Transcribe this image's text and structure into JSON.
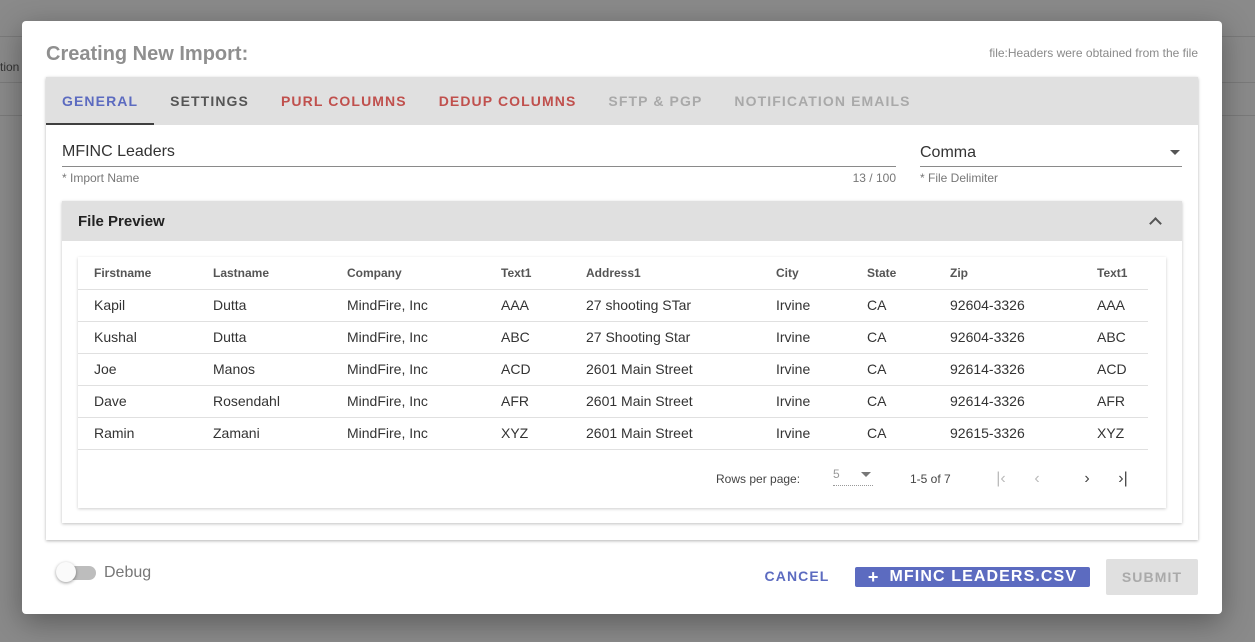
{
  "background": {
    "partial_text": "tion"
  },
  "modal": {
    "title": "Creating New Import:",
    "header_note": "file:Headers were obtained from the file"
  },
  "tabs": [
    {
      "label": "GENERAL",
      "state": "active"
    },
    {
      "label": "SETTINGS",
      "state": "normal"
    },
    {
      "label": "PURL COLUMNS",
      "state": "error"
    },
    {
      "label": "DEDUP COLUMNS",
      "state": "error"
    },
    {
      "label": "SFTP & PGP",
      "state": "disabled"
    },
    {
      "label": "NOTIFICATION EMAILS",
      "state": "disabled"
    }
  ],
  "form": {
    "import_name": {
      "value": "MFINC Leaders",
      "label": "* Import Name",
      "counter": "13 / 100"
    },
    "file_delimiter": {
      "value": "Comma",
      "label": "* File Delimiter"
    }
  },
  "preview": {
    "title": "File Preview",
    "columns": [
      "Firstname",
      "Lastname",
      "Company",
      "Text1",
      "Address1",
      "City",
      "State",
      "Zip",
      "Text1"
    ],
    "rows": [
      [
        "Kapil",
        "Dutta",
        "MindFire, Inc",
        "AAA",
        "27 shooting STar",
        "Irvine",
        "CA",
        "92604-3326",
        "AAA"
      ],
      [
        "Kushal",
        "Dutta",
        "MindFire, Inc",
        "ABC",
        "27 Shooting Star",
        "Irvine",
        "CA",
        "92604-3326",
        "ABC"
      ],
      [
        "Joe",
        "Manos",
        "MindFire, Inc",
        "ACD",
        "2601 Main Street",
        "Irvine",
        "CA",
        "92614-3326",
        "ACD"
      ],
      [
        "Dave",
        "Rosendahl",
        "MindFire, Inc",
        "AFR",
        "2601 Main Street",
        "Irvine",
        "CA",
        "92614-3326",
        "AFR"
      ],
      [
        "Ramin",
        "Zamani",
        "MindFire, Inc",
        "XYZ",
        "2601 Main Street",
        "Irvine",
        "CA",
        "92615-3326",
        "XYZ"
      ]
    ],
    "pagination": {
      "rows_per_page_label": "Rows per page:",
      "rows_per_page": "5",
      "range": "1-5 of 7"
    }
  },
  "footer": {
    "debug_label": "Debug",
    "cancel_label": "CANCEL",
    "file_button_label": "MFINC LEADERS.CSV",
    "submit_label": "SUBMIT"
  },
  "colors": {
    "accent": "#5c6bc0",
    "error": "#c0504d",
    "disabled": "#a9a9a9"
  }
}
